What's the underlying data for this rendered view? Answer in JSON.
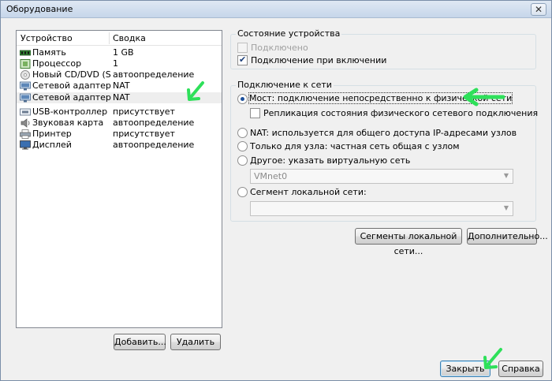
{
  "window": {
    "title": "Оборудование",
    "close_glyph": "✕"
  },
  "device_list": {
    "headers": [
      "Устройство",
      "Сводка"
    ],
    "rows": [
      {
        "name": "Память",
        "summary": "1 GB",
        "icon": "memory-icon"
      },
      {
        "name": "Процессор",
        "summary": "1",
        "icon": "cpu-icon"
      },
      {
        "name": "Новый CD/DVD (SA...",
        "summary": "автоопределение",
        "icon": "cd-dvd-icon"
      },
      {
        "name": "Сетевой адаптер",
        "summary": "NAT",
        "icon": "network-adapter-icon"
      },
      {
        "name": "Сетевой адаптер 2",
        "summary": "NAT",
        "icon": "network-adapter-icon",
        "selected": true
      },
      {
        "name": "USB-контроллер",
        "summary": "присутствует",
        "icon": "usb-icon"
      },
      {
        "name": "Звуковая карта",
        "summary": "автоопределение",
        "icon": "sound-card-icon"
      },
      {
        "name": "Принтер",
        "summary": "присутствует",
        "icon": "printer-icon"
      },
      {
        "name": "Дисплей",
        "summary": "автоопределение",
        "icon": "display-icon"
      }
    ],
    "add_button": "Добавить...",
    "remove_button": "Удалить"
  },
  "device_status": {
    "legend": "Состояние устройства",
    "connected_label": "Подключено",
    "connected_checked": false,
    "connected_enabled": false,
    "connect_on_power_label": "Подключение при включении",
    "connect_on_power_checked": true
  },
  "network_connection": {
    "legend": "Подключение к сети",
    "bridged_label": "Мост: подключение непосредственно к физической сети",
    "replicate_label": "Репликация состояния физического сетевого подключения",
    "replicate_checked": false,
    "nat_label": "NAT: используется для общего доступа IP-адресами узлов",
    "host_only_label": "Только для узла: частная сеть общая с узлом",
    "custom_label": "Другое: указать виртуальную сеть",
    "custom_value": "VMnet0",
    "lan_segment_label": "Сегмент локальной сети:",
    "lan_segment_value": "",
    "selected_option": "bridged"
  },
  "buttons": {
    "lan_segments": "Сегменты локальной сети...",
    "advanced": "Дополнительно...",
    "close": "Закрыть",
    "help": "Справка"
  },
  "colors": {
    "annotation_arrow": "#2ee05a",
    "selection_row": "#eeeeee",
    "radio_dot": "#1b4f9c"
  }
}
